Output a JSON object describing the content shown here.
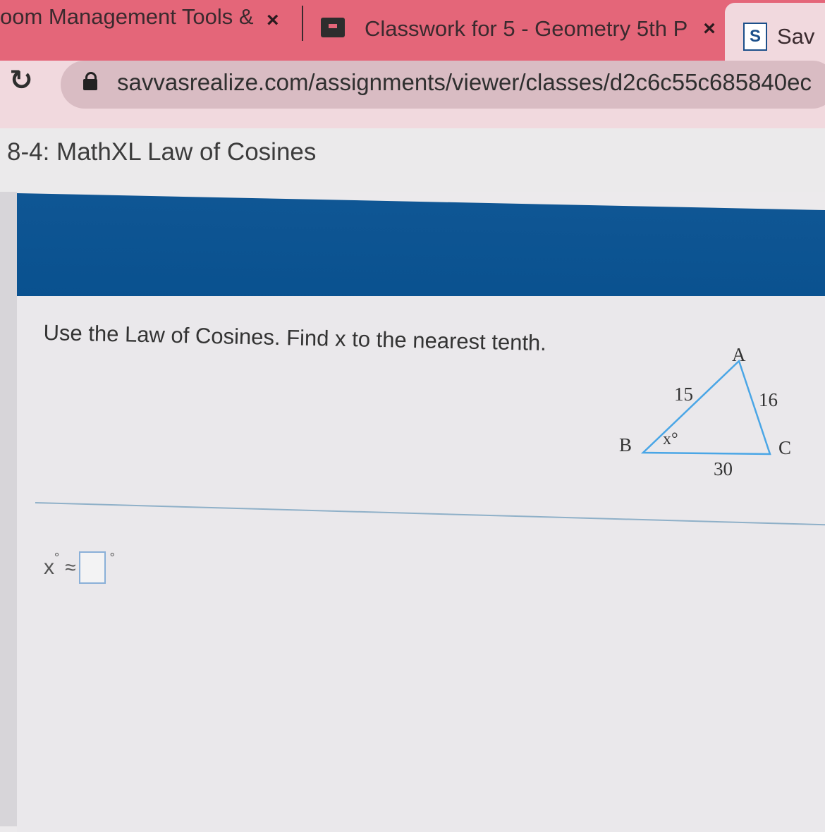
{
  "browser": {
    "tabs": [
      {
        "title": "oom Management Tools &",
        "close": "×"
      },
      {
        "title": "Classwork for 5 - Geometry 5th P",
        "close": "×"
      },
      {
        "title": "Sav",
        "favicon": "S"
      }
    ],
    "reload_icon": "↻",
    "url": "savvasrealize.com/assignments/viewer/classes/d2c6c55c685840ec"
  },
  "page": {
    "assignment_title": "8-4: MathXL Law of Cosines",
    "banner_color": "#0b5291"
  },
  "question": {
    "prompt": "Use the Law of Cosines. Find x to the nearest tenth.",
    "figure": {
      "vertices": {
        "A": "A",
        "B": "B",
        "C": "C"
      },
      "sides": {
        "AB": "15",
        "AC": "16",
        "BC": "30"
      },
      "angle_label": "x°"
    },
    "answer": {
      "variable": "x",
      "degree": "°",
      "approx": "≈",
      "value": "",
      "unit": "°"
    }
  }
}
